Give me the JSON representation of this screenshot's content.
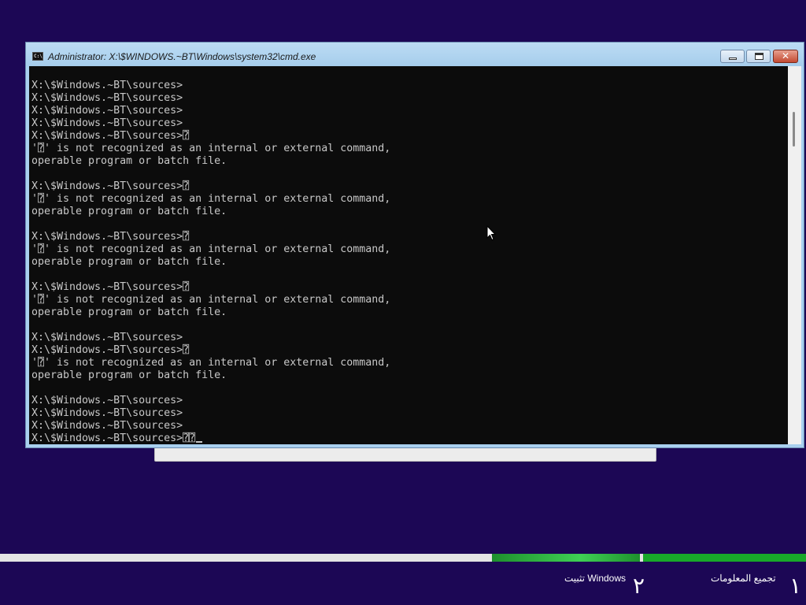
{
  "window": {
    "title": "Administrator: X:\\$WINDOWS.~BT\\Windows\\system32\\cmd.exe",
    "icon": "cmd-icon",
    "controls": {
      "minimize": "minimize-icon",
      "maximize": "maximize-icon",
      "close": "✕"
    }
  },
  "console": {
    "lines": [
      "X:\\$Windows.~BT\\sources>",
      "X:\\$Windows.~BT\\sources>",
      "X:\\$Windows.~BT\\sources>",
      "X:\\$Windows.~BT\\sources>",
      "X:\\$Windows.~BT\\sources>⍰",
      "'⍰' is not recognized as an internal or external command,",
      "operable program or batch file.",
      "",
      "X:\\$Windows.~BT\\sources>⍰",
      "'⍰' is not recognized as an internal or external command,",
      "operable program or batch file.",
      "",
      "X:\\$Windows.~BT\\sources>⍰",
      "'⍰' is not recognized as an internal or external command,",
      "operable program or batch file.",
      "",
      "X:\\$Windows.~BT\\sources>⍰",
      "'⍰' is not recognized as an internal or external command,",
      "operable program or batch file.",
      "",
      "X:\\$Windows.~BT\\sources>",
      "X:\\$Windows.~BT\\sources>⍰",
      "'⍰' is not recognized as an internal or external command,",
      "operable program or batch file.",
      "",
      "X:\\$Windows.~BT\\sources>",
      "X:\\$Windows.~BT\\sources>",
      "X:\\$Windows.~BT\\sources>",
      "X:\\$Windows.~BT\\sources>⍰⍰"
    ]
  },
  "setup": {
    "steps": [
      {
        "number": "١",
        "label": "تجميع المعلومات"
      },
      {
        "number": "٢",
        "label": "تثبيت Windows"
      }
    ],
    "colors": {
      "background": "#1c0755",
      "progress": "#18a82a"
    }
  }
}
